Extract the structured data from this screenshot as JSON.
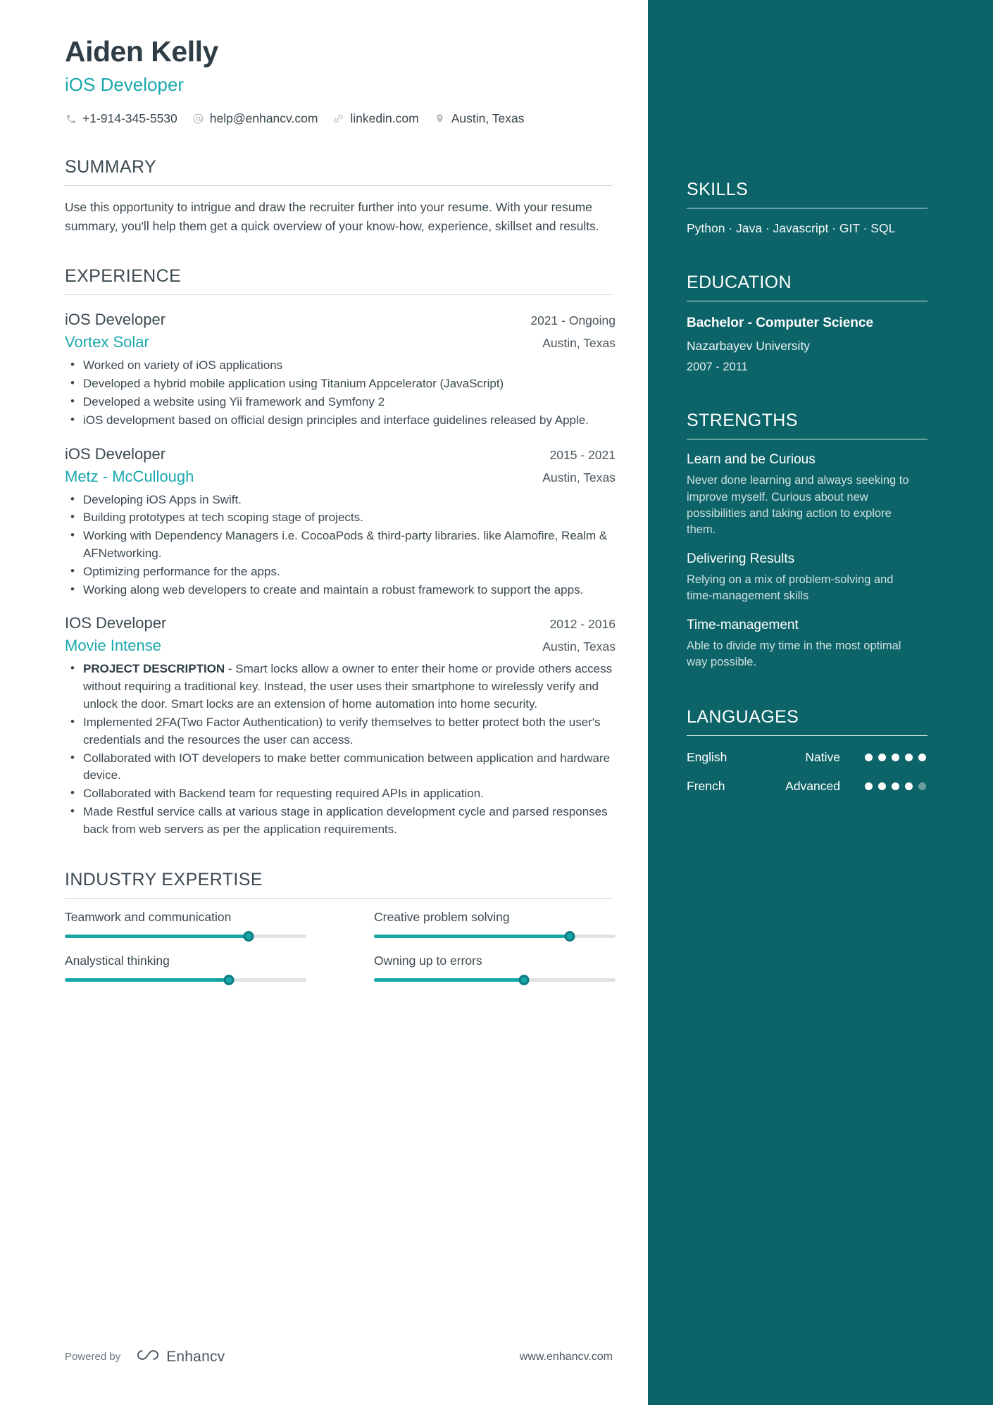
{
  "header": {
    "name": "Aiden Kelly",
    "title": "iOS Developer",
    "contacts": [
      {
        "icon": "phone-icon",
        "text": "+1-914-345-5530"
      },
      {
        "icon": "at-email-icon",
        "text": "help@enhancv.com"
      },
      {
        "icon": "link-icon",
        "text": "linkedin.com"
      },
      {
        "icon": "location-pin-icon",
        "text": "Austin, Texas"
      }
    ]
  },
  "summary": {
    "title": "SUMMARY",
    "text": "Use this opportunity to intrigue and draw the recruiter further into your resume. With your resume summary, you'll help them get a quick overview of your know-how, experience, skillset and results."
  },
  "experience": {
    "title": "EXPERIENCE",
    "entries": [
      {
        "role": "iOS Developer",
        "dates": "2021 - Ongoing",
        "company": "Vortex Solar",
        "location": "Austin, Texas",
        "bullets": [
          {
            "lead": "",
            "text": "Worked on variety of iOS applications"
          },
          {
            "lead": "",
            "text": "Developed a hybrid mobile application using Titanium Appcelerator (JavaScript)"
          },
          {
            "lead": "",
            "text": "Developed a website using Yii framework and Symfony 2"
          },
          {
            "lead": "",
            "text": "iOS development based on official design principles and interface guidelines released by Apple."
          }
        ]
      },
      {
        "role": "iOS Developer",
        "dates": "2015 - 2021",
        "company": "Metz - McCullough",
        "location": "Austin, Texas",
        "bullets": [
          {
            "lead": "",
            "text": "Developing iOS Apps in Swift."
          },
          {
            "lead": "",
            "text": "Building prototypes at tech scoping stage of projects."
          },
          {
            "lead": "",
            "text": "Working with Dependency Managers i.e. CocoaPods & third-party libraries. like Alamofire, Realm & AFNetworking."
          },
          {
            "lead": "",
            "text": "Optimizing performance for the apps."
          },
          {
            "lead": "",
            "text": "Working along web developers to create and maintain a robust framework to support the apps."
          }
        ]
      },
      {
        "role": "IOS Developer",
        "dates": "2012 - 2016",
        "company": "Movie Intense",
        "location": "Austin, Texas",
        "bullets": [
          {
            "lead": "PROJECT DESCRIPTION",
            "text": " - Smart locks allow a owner to enter their home or provide others access without requiring a traditional key. Instead, the user uses their smartphone to wirelessly verify and unlock the door. Smart locks are an extension of home automation into home security."
          },
          {
            "lead": "",
            "text": "Implemented 2FA(Two Factor Authentication) to verify themselves to better protect both the user's credentials and the resources the user can access."
          },
          {
            "lead": "",
            "text": "Collaborated with IOT developers to make better communication between application and hardware device."
          },
          {
            "lead": "",
            "text": "Collaborated with Backend team for requesting required APIs in application."
          },
          {
            "lead": "",
            "text": "Made Restful service calls at various stage in application development cycle and parsed responses back from web servers as per the application requirements."
          }
        ]
      }
    ]
  },
  "industry_expertise": {
    "title": "INDUSTRY EXPERTISE",
    "items": [
      {
        "label": "Teamwork and communication",
        "value": 76
      },
      {
        "label": "Creative problem solving",
        "value": 81
      },
      {
        "label": "Analystical thinking",
        "value": 68
      },
      {
        "label": "Owning up to errors",
        "value": 62
      }
    ]
  },
  "footer": {
    "powered_by": "Powered by",
    "brand": "Enhancv",
    "url": "www.enhancv.com"
  },
  "sidebar": {
    "skills": {
      "title": "SKILLS",
      "list": "Python · Java · Javascript · GIT · SQL"
    },
    "education": {
      "title": "EDUCATION",
      "degree": "Bachelor - Computer Science",
      "school": "Nazarbayev University",
      "dates": "2007 - 2011"
    },
    "strengths": {
      "title": "STRENGTHS",
      "items": [
        {
          "name": "Learn and be Curious",
          "desc": "Never done learning and always seeking to improve myself. Curious about new possibilities and taking action to explore them."
        },
        {
          "name": "Delivering Results",
          "desc": "Relying on a mix of problem-solving and time-management skills"
        },
        {
          "name": "Time-management",
          "desc": "Able to divide my time in the most optimal way possible."
        }
      ]
    },
    "languages": {
      "title": "LANGUAGES",
      "items": [
        {
          "name": "English",
          "level": "Native",
          "dots": 5,
          "total": 5
        },
        {
          "name": "French",
          "level": "Advanced",
          "dots": 4,
          "total": 5
        }
      ]
    }
  },
  "colors": {
    "accent_teal": "#1aa8ad",
    "sidebar_bg": "#0c6368",
    "text_dark": "#36474f",
    "slider_fill": "#16a6a6"
  }
}
